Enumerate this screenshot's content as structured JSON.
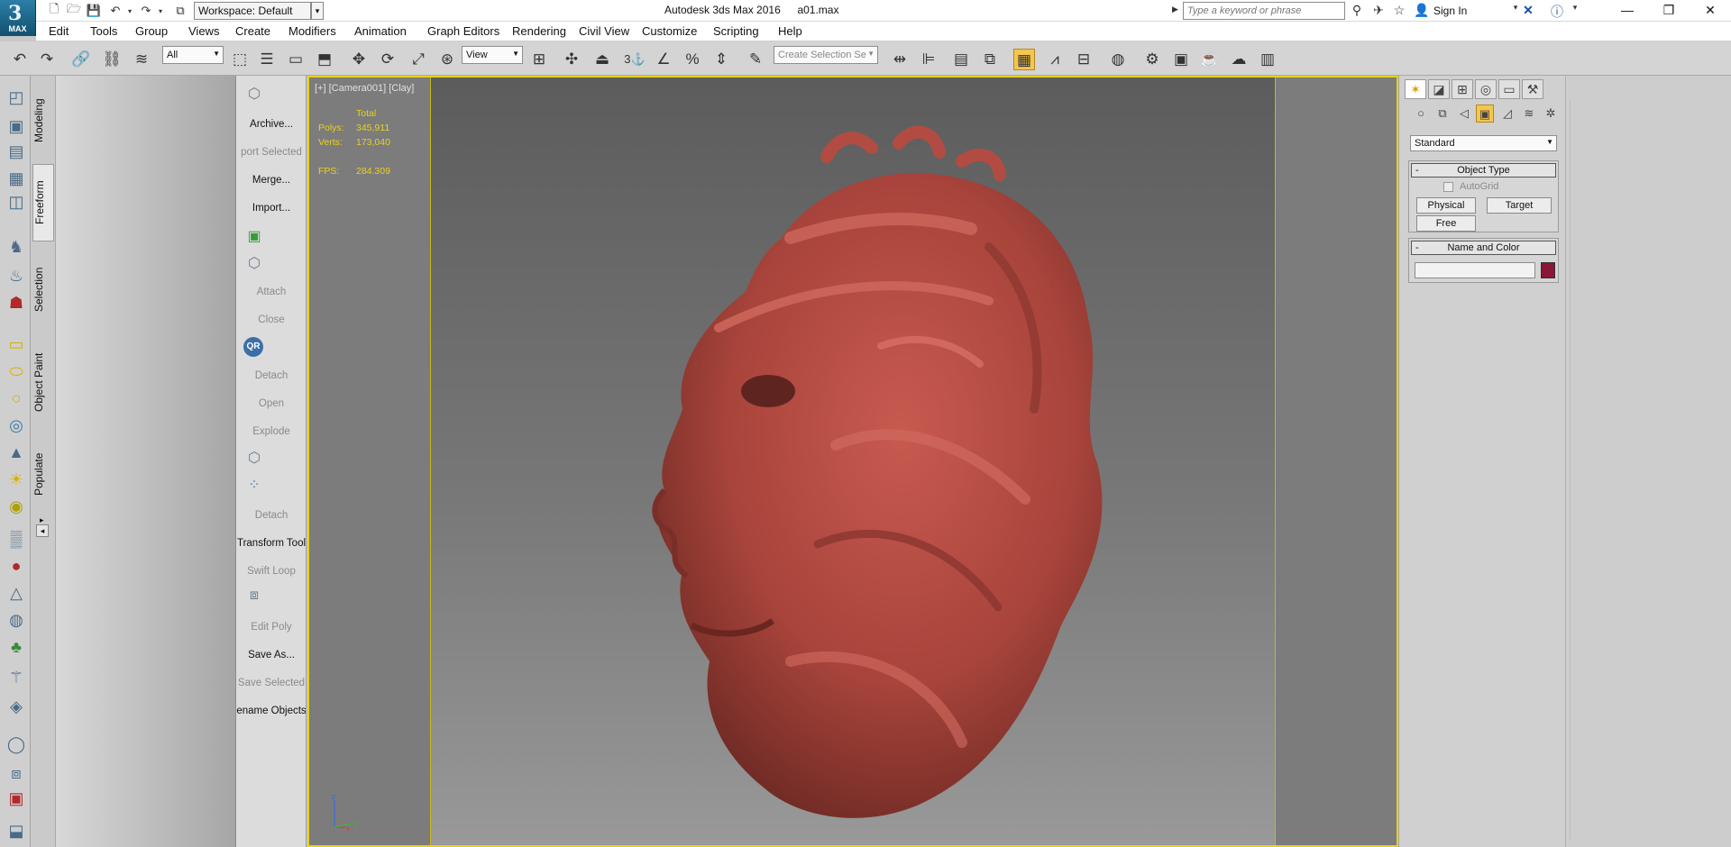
{
  "window": {
    "title": "Autodesk 3ds Max 2016",
    "filename": "a01.max",
    "logo_text": "MAX",
    "workspace_label": "Workspace: Default"
  },
  "search": {
    "placeholder": "Type a keyword or phrase"
  },
  "account": {
    "sign_in_label": "Sign In"
  },
  "menu": [
    "Edit",
    "Tools",
    "Group",
    "Views",
    "Create",
    "Modifiers",
    "Animation",
    "Graph Editors",
    "Rendering",
    "Civil View",
    "Customize",
    "Scripting",
    "Help"
  ],
  "toolbar": {
    "selection_filter": "All",
    "reference_coord": "View",
    "named_selection_placeholder": "Create Selection Se",
    "snap_label": "3"
  },
  "ribbon_tabs": [
    "Modeling",
    "Freeform",
    "Selection",
    "Object Paint",
    "Populate"
  ],
  "tool_column": [
    {
      "label": "Archive...",
      "enabled": true
    },
    {
      "label": "port Selected",
      "enabled": false
    },
    {
      "label": "Merge...",
      "enabled": true
    },
    {
      "label": "Import...",
      "enabled": true
    },
    {
      "label": "Attach",
      "enabled": false
    },
    {
      "label": "Close",
      "enabled": false
    },
    {
      "label": "Detach",
      "enabled": false
    },
    {
      "label": "Open",
      "enabled": false
    },
    {
      "label": "Explode",
      "enabled": false
    },
    {
      "label": "Detach",
      "enabled": false
    },
    {
      "label": "Transform Tool",
      "enabled": true
    },
    {
      "label": "Swift Loop",
      "enabled": false
    },
    {
      "label": "Edit Poly",
      "enabled": false
    },
    {
      "label": "Save As...",
      "enabled": true
    },
    {
      "label": "Save Selected",
      "enabled": false
    },
    {
      "label": "ename Objects",
      "enabled": true
    }
  ],
  "tool_badge": "QR",
  "viewport": {
    "label": "[+] [Camera001] [Clay]",
    "stats": {
      "header": "Total",
      "polys_label": "Polys:",
      "polys_value": "345,911",
      "verts_label": "Verts:",
      "verts_value": "173,040",
      "fps_label": "FPS:",
      "fps_value": "284.309"
    },
    "axis": {
      "x": "x",
      "y": "y",
      "z": "z"
    },
    "colors": {
      "border": "#e6d21a",
      "stats_text": "#e8d21e",
      "model": "#b84a40"
    }
  },
  "command_panel": {
    "category_dropdown": "Standard",
    "object_type": {
      "title": "Object Type",
      "autogrid_label": "AutoGrid",
      "buttons": [
        "Physical",
        "Target",
        "Free"
      ]
    },
    "name_and_color": {
      "title": "Name and Color",
      "name_value": "",
      "color": "#8a1638"
    },
    "collapse_symbol": "-"
  }
}
